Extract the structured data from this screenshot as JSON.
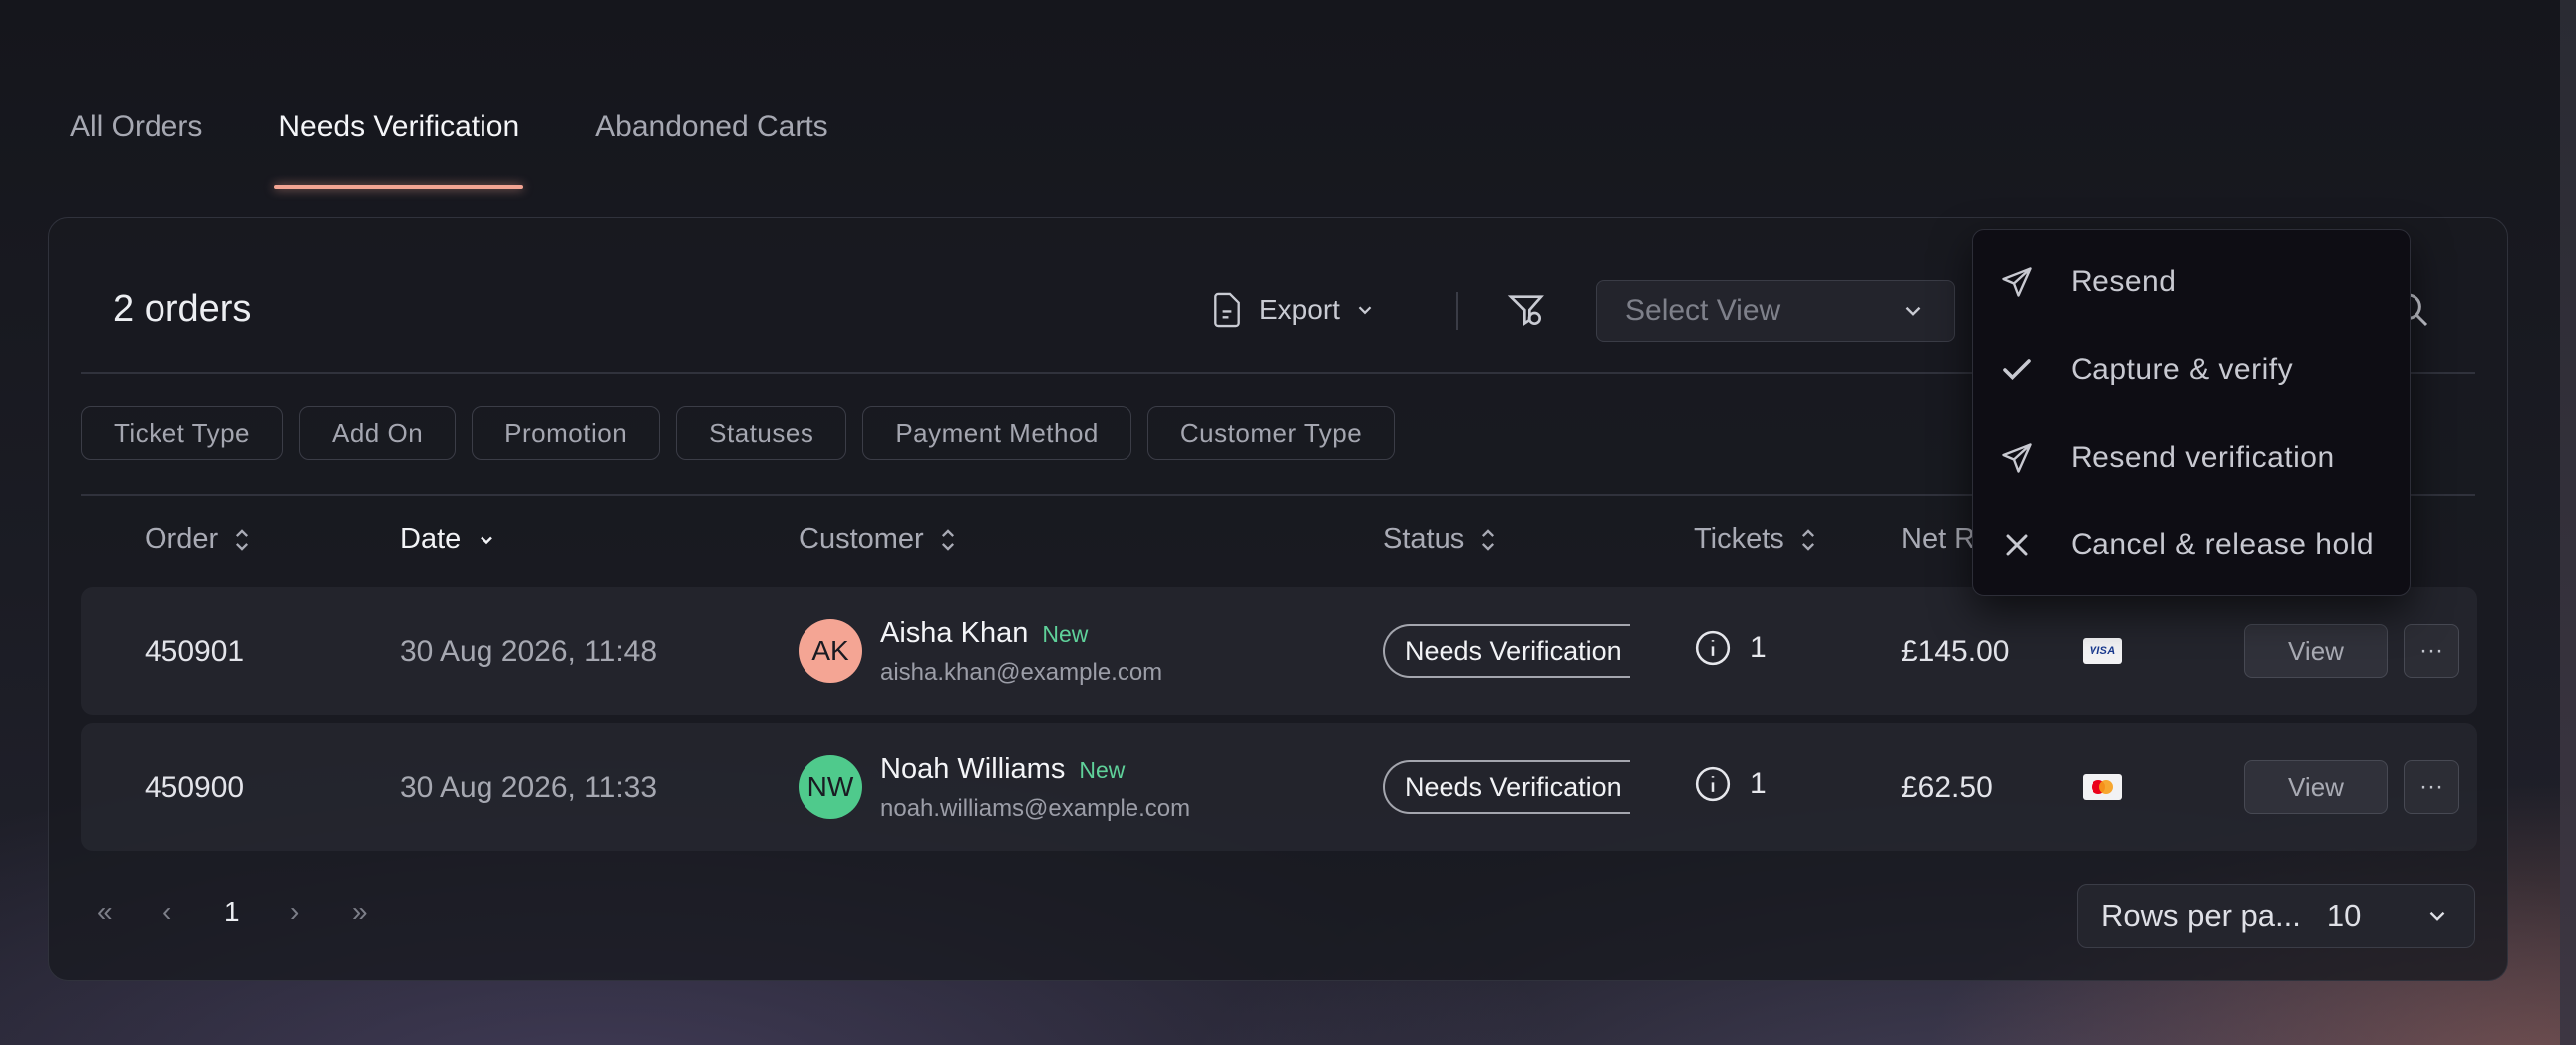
{
  "tabs": [
    {
      "label": "All Orders"
    },
    {
      "label": "Needs Verification"
    },
    {
      "label": "Abandoned Carts"
    }
  ],
  "toolbar": {
    "order_count": "2 orders",
    "export_label": "Export",
    "select_view_placeholder": "Select View"
  },
  "filters": [
    "Ticket Type",
    "Add On",
    "Promotion",
    "Statuses",
    "Payment Method",
    "Customer Type"
  ],
  "columns": {
    "order": "Order",
    "date": "Date",
    "customer": "Customer",
    "status": "Status",
    "tickets": "Tickets",
    "net": "Net R"
  },
  "rows": [
    {
      "order": "450901",
      "date": "30 Aug 2026, 11:48",
      "initials": "AK",
      "avatar_color": "#f4a594",
      "name": "Aisha Khan",
      "tag": "New",
      "email": "aisha.khan@example.com",
      "status": "Needs Verification",
      "tickets": "1",
      "net": "£145.00",
      "payment": "VISA",
      "view_label": "View"
    },
    {
      "order": "450900",
      "date": "30 Aug 2026, 11:33",
      "initials": "NW",
      "avatar_color": "#4fca8c",
      "name": "Noah Williams",
      "tag": "New",
      "email": "noah.williams@example.com",
      "status": "Needs Verification",
      "tickets": "1",
      "net": "£62.50",
      "payment": "mastercard",
      "view_label": "View"
    }
  ],
  "pagination": {
    "first": "«",
    "prev": "‹",
    "current_page": "1",
    "next": "›",
    "last": "»",
    "rows_per_page_label": "Rows per pa...",
    "rows_per_page_value": "10"
  },
  "menu": {
    "items": [
      {
        "label": "Resend",
        "icon": "send-icon"
      },
      {
        "label": "Capture & verify",
        "icon": "check-icon"
      },
      {
        "label": "Resend verification",
        "icon": "send-icon"
      },
      {
        "label": "Cancel & release hold",
        "icon": "close-icon"
      }
    ]
  },
  "colors": {
    "accent": "#f2a493",
    "new_tag": "#5fd19a"
  }
}
